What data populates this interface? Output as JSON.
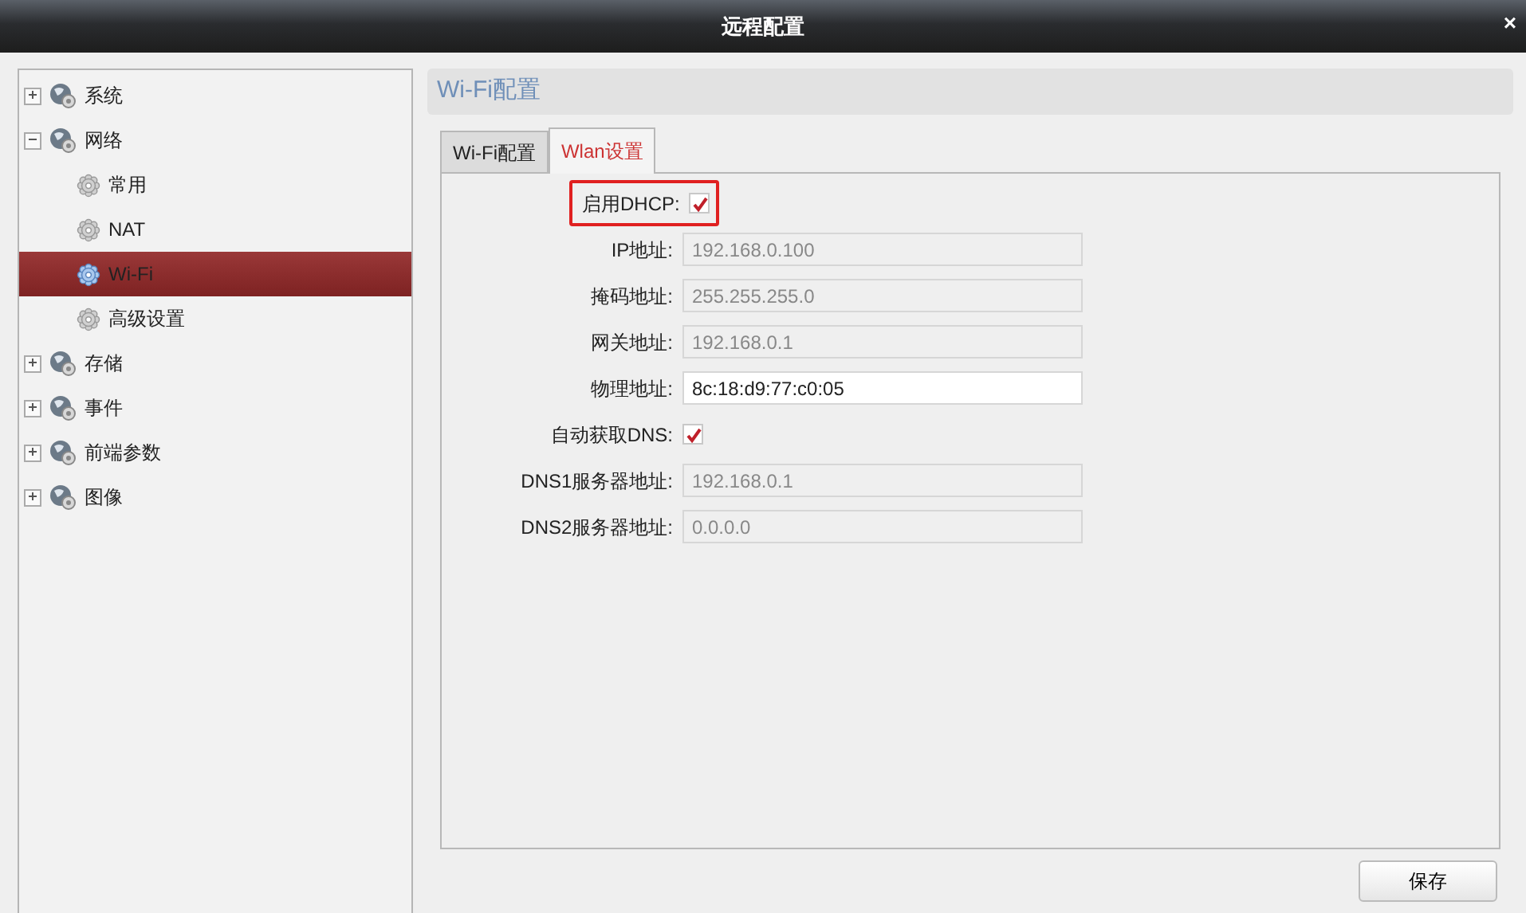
{
  "window": {
    "title": "远程配置",
    "close": "×"
  },
  "sidebar": {
    "items": [
      {
        "label": "系统",
        "expanded": false
      },
      {
        "label": "网络",
        "expanded": true,
        "children": [
          {
            "label": "常用",
            "selected": false
          },
          {
            "label": "NAT",
            "selected": false
          },
          {
            "label": "Wi-Fi",
            "selected": true
          },
          {
            "label": "高级设置",
            "selected": false
          }
        ]
      },
      {
        "label": "存储",
        "expanded": false
      },
      {
        "label": "事件",
        "expanded": false
      },
      {
        "label": "前端参数",
        "expanded": false
      },
      {
        "label": "图像",
        "expanded": false
      }
    ]
  },
  "panel": {
    "title": "Wi-Fi配置",
    "tabs": [
      {
        "label": "Wi-Fi配置",
        "selected": false
      },
      {
        "label": "Wlan设置",
        "selected": true
      }
    ],
    "fields": [
      {
        "kind": "checkbox",
        "label": "启用DHCP:",
        "checked": true,
        "highlighted": true
      },
      {
        "kind": "text",
        "label": "IP地址:",
        "value": "192.168.0.100",
        "disabled": true
      },
      {
        "kind": "text",
        "label": "掩码地址:",
        "value": "255.255.255.0",
        "disabled": true
      },
      {
        "kind": "text",
        "label": "网关地址:",
        "value": "192.168.0.1",
        "disabled": true
      },
      {
        "kind": "text",
        "label": "物理地址:",
        "value": "8c:18:d9:77:c0:05",
        "disabled": false
      },
      {
        "kind": "checkbox",
        "label": "自动获取DNS:",
        "checked": true,
        "highlighted": false
      },
      {
        "kind": "text",
        "label": "DNS1服务器地址:",
        "value": "192.168.0.1",
        "disabled": true
      },
      {
        "kind": "text",
        "label": "DNS2服务器地址:",
        "value": "0.0.0.0",
        "disabled": true
      }
    ],
    "save_button": "保存"
  }
}
